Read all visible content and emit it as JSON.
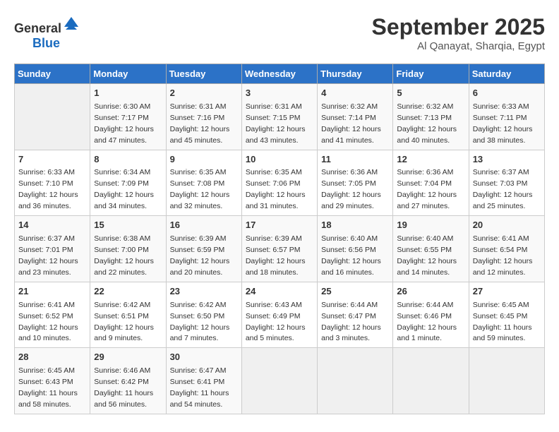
{
  "header": {
    "logo_general": "General",
    "logo_blue": "Blue",
    "month": "September 2025",
    "location": "Al Qanayat, Sharqia, Egypt"
  },
  "columns": [
    "Sunday",
    "Monday",
    "Tuesday",
    "Wednesday",
    "Thursday",
    "Friday",
    "Saturday"
  ],
  "weeks": [
    [
      {
        "day": "",
        "info": ""
      },
      {
        "day": "1",
        "info": "Sunrise: 6:30 AM\nSunset: 7:17 PM\nDaylight: 12 hours\nand 47 minutes."
      },
      {
        "day": "2",
        "info": "Sunrise: 6:31 AM\nSunset: 7:16 PM\nDaylight: 12 hours\nand 45 minutes."
      },
      {
        "day": "3",
        "info": "Sunrise: 6:31 AM\nSunset: 7:15 PM\nDaylight: 12 hours\nand 43 minutes."
      },
      {
        "day": "4",
        "info": "Sunrise: 6:32 AM\nSunset: 7:14 PM\nDaylight: 12 hours\nand 41 minutes."
      },
      {
        "day": "5",
        "info": "Sunrise: 6:32 AM\nSunset: 7:13 PM\nDaylight: 12 hours\nand 40 minutes."
      },
      {
        "day": "6",
        "info": "Sunrise: 6:33 AM\nSunset: 7:11 PM\nDaylight: 12 hours\nand 38 minutes."
      }
    ],
    [
      {
        "day": "7",
        "info": "Sunrise: 6:33 AM\nSunset: 7:10 PM\nDaylight: 12 hours\nand 36 minutes."
      },
      {
        "day": "8",
        "info": "Sunrise: 6:34 AM\nSunset: 7:09 PM\nDaylight: 12 hours\nand 34 minutes."
      },
      {
        "day": "9",
        "info": "Sunrise: 6:35 AM\nSunset: 7:08 PM\nDaylight: 12 hours\nand 32 minutes."
      },
      {
        "day": "10",
        "info": "Sunrise: 6:35 AM\nSunset: 7:06 PM\nDaylight: 12 hours\nand 31 minutes."
      },
      {
        "day": "11",
        "info": "Sunrise: 6:36 AM\nSunset: 7:05 PM\nDaylight: 12 hours\nand 29 minutes."
      },
      {
        "day": "12",
        "info": "Sunrise: 6:36 AM\nSunset: 7:04 PM\nDaylight: 12 hours\nand 27 minutes."
      },
      {
        "day": "13",
        "info": "Sunrise: 6:37 AM\nSunset: 7:03 PM\nDaylight: 12 hours\nand 25 minutes."
      }
    ],
    [
      {
        "day": "14",
        "info": "Sunrise: 6:37 AM\nSunset: 7:01 PM\nDaylight: 12 hours\nand 23 minutes."
      },
      {
        "day": "15",
        "info": "Sunrise: 6:38 AM\nSunset: 7:00 PM\nDaylight: 12 hours\nand 22 minutes."
      },
      {
        "day": "16",
        "info": "Sunrise: 6:39 AM\nSunset: 6:59 PM\nDaylight: 12 hours\nand 20 minutes."
      },
      {
        "day": "17",
        "info": "Sunrise: 6:39 AM\nSunset: 6:57 PM\nDaylight: 12 hours\nand 18 minutes."
      },
      {
        "day": "18",
        "info": "Sunrise: 6:40 AM\nSunset: 6:56 PM\nDaylight: 12 hours\nand 16 minutes."
      },
      {
        "day": "19",
        "info": "Sunrise: 6:40 AM\nSunset: 6:55 PM\nDaylight: 12 hours\nand 14 minutes."
      },
      {
        "day": "20",
        "info": "Sunrise: 6:41 AM\nSunset: 6:54 PM\nDaylight: 12 hours\nand 12 minutes."
      }
    ],
    [
      {
        "day": "21",
        "info": "Sunrise: 6:41 AM\nSunset: 6:52 PM\nDaylight: 12 hours\nand 10 minutes."
      },
      {
        "day": "22",
        "info": "Sunrise: 6:42 AM\nSunset: 6:51 PM\nDaylight: 12 hours\nand 9 minutes."
      },
      {
        "day": "23",
        "info": "Sunrise: 6:42 AM\nSunset: 6:50 PM\nDaylight: 12 hours\nand 7 minutes."
      },
      {
        "day": "24",
        "info": "Sunrise: 6:43 AM\nSunset: 6:49 PM\nDaylight: 12 hours\nand 5 minutes."
      },
      {
        "day": "25",
        "info": "Sunrise: 6:44 AM\nSunset: 6:47 PM\nDaylight: 12 hours\nand 3 minutes."
      },
      {
        "day": "26",
        "info": "Sunrise: 6:44 AM\nSunset: 6:46 PM\nDaylight: 12 hours\nand 1 minute."
      },
      {
        "day": "27",
        "info": "Sunrise: 6:45 AM\nSunset: 6:45 PM\nDaylight: 11 hours\nand 59 minutes."
      }
    ],
    [
      {
        "day": "28",
        "info": "Sunrise: 6:45 AM\nSunset: 6:43 PM\nDaylight: 11 hours\nand 58 minutes."
      },
      {
        "day": "29",
        "info": "Sunrise: 6:46 AM\nSunset: 6:42 PM\nDaylight: 11 hours\nand 56 minutes."
      },
      {
        "day": "30",
        "info": "Sunrise: 6:47 AM\nSunset: 6:41 PM\nDaylight: 11 hours\nand 54 minutes."
      },
      {
        "day": "",
        "info": ""
      },
      {
        "day": "",
        "info": ""
      },
      {
        "day": "",
        "info": ""
      },
      {
        "day": "",
        "info": ""
      }
    ]
  ]
}
